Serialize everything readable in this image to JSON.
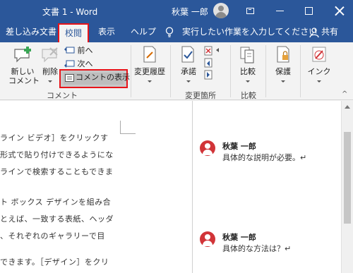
{
  "window": {
    "title": "文書 1 - Word",
    "user_name": "秋葉 一郎",
    "accent_color": "#2b579a"
  },
  "tabs": {
    "mailings": "差し込み文書",
    "review": "校閲",
    "view": "表示",
    "help": "ヘルプ",
    "tell_me": "実行したい作業を入力してください",
    "share": "共有",
    "active": "review"
  },
  "ribbon": {
    "new_comment": [
      "新しい",
      "コメント"
    ],
    "delete": "削除",
    "previous": "前へ",
    "next": "次へ",
    "show_comments": "コメントの表示",
    "comments_group": "コメント",
    "track_changes": "変更履歴",
    "accept": "承諾",
    "changes_group": "変更箇所",
    "compare": "比較",
    "compare_group": "比較",
    "protect": "保護",
    "ink": "インク"
  },
  "document": {
    "lines": [
      "ライン ビデオ］をクリックす",
      "形式で貼り付けできるようにな",
      "ラインで検索することもできま",
      "ト ボックス デザインを組み合",
      "とえば、一致する表紙、ヘッダ",
      "、それぞれのギャラリーで目",
      "できます。［デザイン］をクリ"
    ]
  },
  "comments": [
    {
      "author": "秋葉 一郎",
      "text": "具体的な説明が必要。↵"
    },
    {
      "author": "秋葉 一郎",
      "text": "具体的な方法は？↵"
    }
  ],
  "colors": {
    "highlight_border": "#e8141a",
    "comment_avatar": "#d13438"
  }
}
